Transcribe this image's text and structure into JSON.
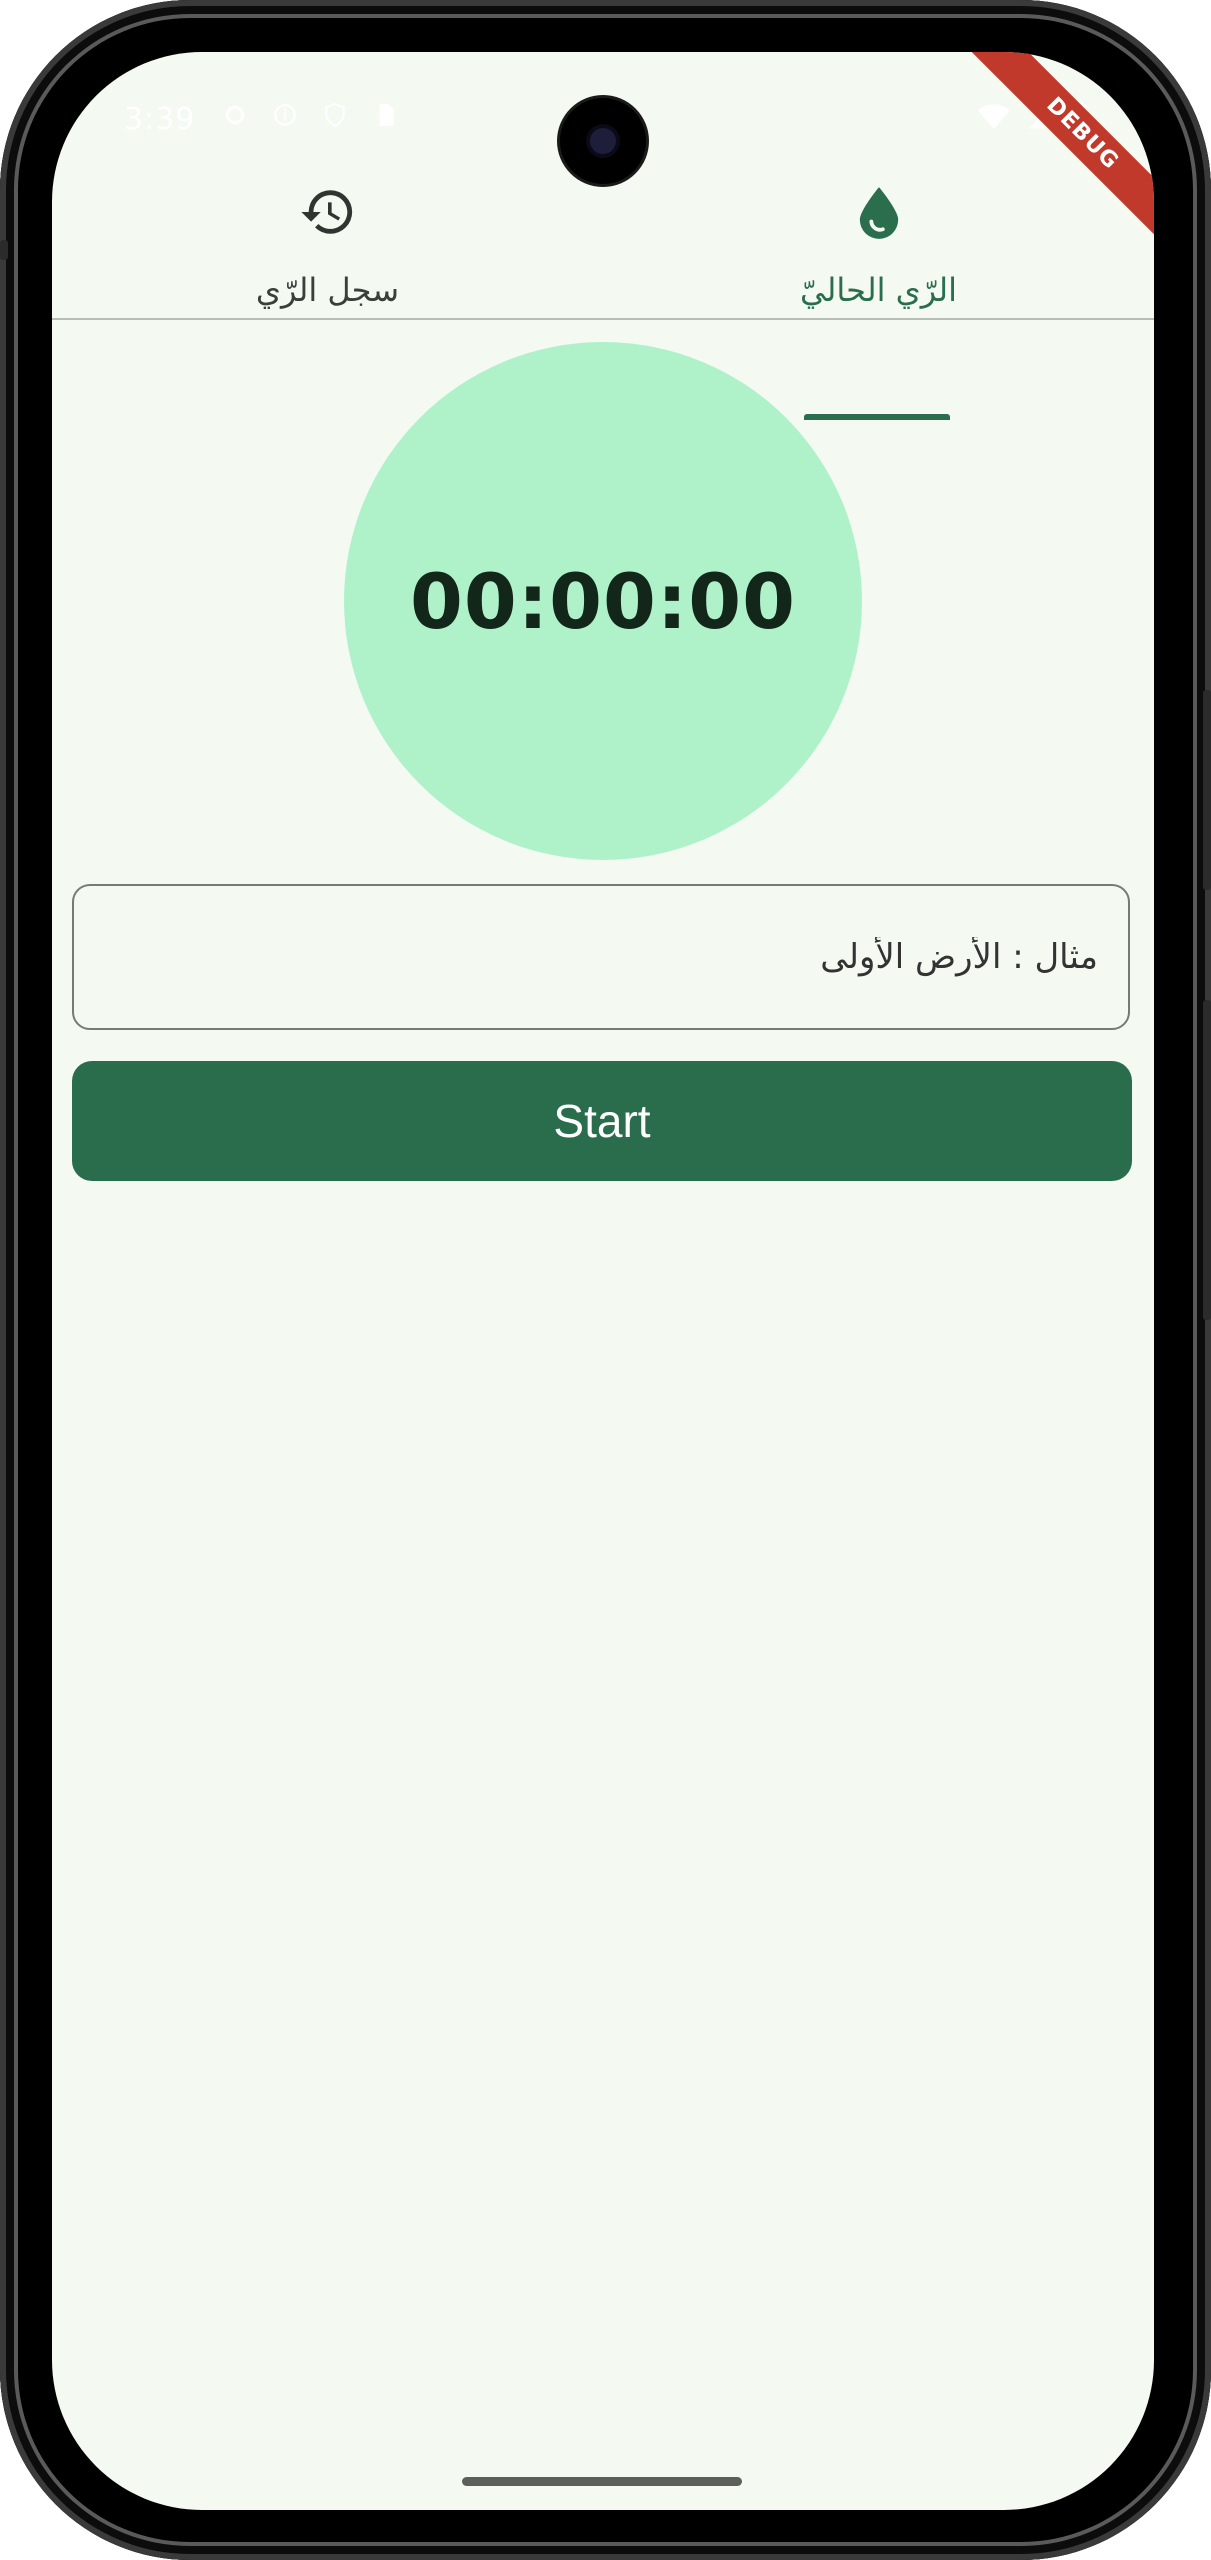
{
  "status_bar": {
    "time": "3:39"
  },
  "debug_banner": "DEBUG",
  "tabs": [
    {
      "label": "سجل الرّي",
      "icon": "history-icon",
      "selected": false
    },
    {
      "label": "الرّي الحاليّ",
      "icon": "water-drop-icon",
      "selected": true
    }
  ],
  "timer": {
    "display": "00:00:00"
  },
  "field": {
    "placeholder": "مثال : الأرض الأولى"
  },
  "start_button": {
    "label": "Start"
  },
  "colors": {
    "background": "#f4f9f2",
    "primary": "#2a6e4e",
    "timer_circle": "#aff2ca",
    "tab_divider": "#b8bdb6"
  }
}
